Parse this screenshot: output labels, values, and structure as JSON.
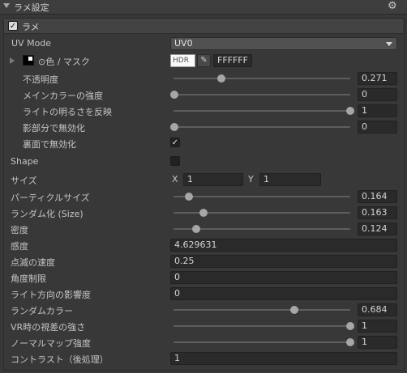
{
  "header": {
    "title": "ラメ設定"
  },
  "section": {
    "label": "ラメ",
    "enabled": true
  },
  "uv_mode": {
    "label": "UV Mode",
    "value": "UV0"
  },
  "color_mask": {
    "label": "⊙色 / マスク",
    "hdr": "HDR",
    "hex": "FFFFFF",
    "swatch_color": "#000000"
  },
  "opacity": {
    "label": "不透明度",
    "value": "0.271",
    "level": 0.271
  },
  "main_strength": {
    "label": "メインカラーの強度",
    "value": "0",
    "level": 0
  },
  "light_reflect": {
    "label": "ライトの明るさを反映",
    "value": "1",
    "level": 1
  },
  "shadow_disable": {
    "label": "影部分で無効化",
    "value": "0",
    "level": 0
  },
  "backface_disable": {
    "label": "裏面で無効化",
    "checked": true
  },
  "shape": {
    "label": "Shape"
  },
  "size": {
    "label": "サイズ",
    "x_label": "X",
    "x": "1",
    "y_label": "Y",
    "y": "1"
  },
  "particle_size": {
    "label": "パーティクルサイズ",
    "value": "0.164",
    "level": 0.092
  },
  "random_size": {
    "label": "ランダム化 (Size)",
    "value": "0.163",
    "level": 0.163
  },
  "density": {
    "label": "密度",
    "value": "0.124",
    "level": 0.124
  },
  "sensitivity": {
    "label": "感度",
    "value": "4.629631"
  },
  "blink_speed": {
    "label": "点滅の速度",
    "value": "0.25"
  },
  "angle_limit": {
    "label": "角度制限",
    "value": "0"
  },
  "light_dir": {
    "label": "ライト方向の影響度",
    "value": "0"
  },
  "random_color": {
    "label": "ランダムカラー",
    "value": "0.684",
    "level": 0.684
  },
  "vr_parallax": {
    "label": "VR時の視差の強さ",
    "value": "1",
    "level": 1
  },
  "normal_strength": {
    "label": "ノーマルマップ強度",
    "value": "1",
    "level": 1
  },
  "contrast": {
    "label": "コントラスト（後処理）",
    "value": "1"
  }
}
